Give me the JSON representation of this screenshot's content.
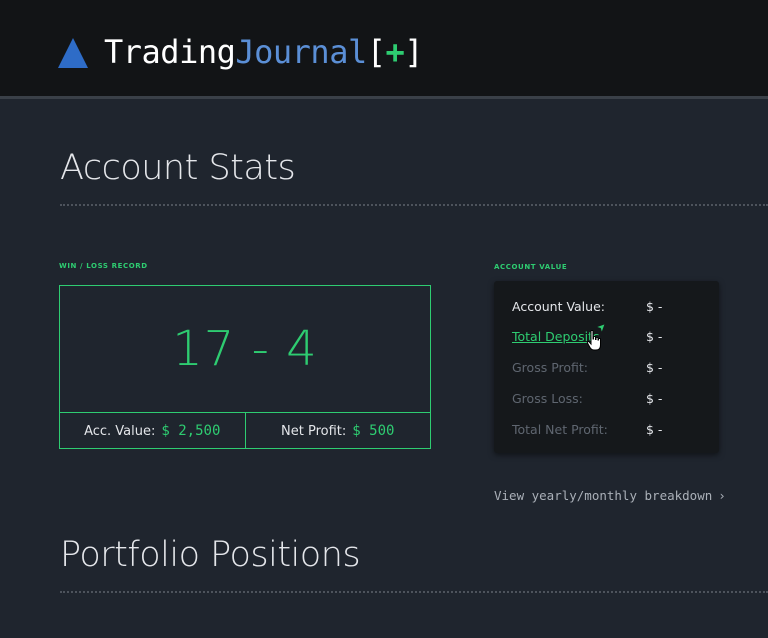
{
  "header": {
    "logo_part1": "Trading",
    "logo_part2": "Journal",
    "logo_open": "[",
    "logo_plus": "+",
    "logo_close": "]"
  },
  "account_stats": {
    "title": "Account Stats",
    "win_loss": {
      "label": "WIN / LOSS RECORD",
      "record": "17 - 4",
      "acc_value_label": "Acc. Value:",
      "acc_value": "$ 2,500",
      "net_profit_label": "Net Profit:",
      "net_profit": "$ 500"
    },
    "account_value": {
      "label": "ACCOUNT VALUE",
      "rows": [
        {
          "label": "Account Value:",
          "value": "$  -"
        },
        {
          "label": "Total Deposits",
          "value": "$  -"
        },
        {
          "label": "Gross Profit:",
          "value": "$  -"
        },
        {
          "label": "Gross Loss:",
          "value": "$  -"
        },
        {
          "label": "Total Net Profit:",
          "value": "$  -"
        }
      ]
    },
    "breakdown_link": "View yearly/monthly breakdown",
    "breakdown_chevron": "›"
  },
  "portfolio": {
    "title": "Portfolio Positions"
  },
  "colors": {
    "accent": "#2ecc71",
    "logo_triangle": "#2e6cc7",
    "logo_journal": "#5b8fd6",
    "background": "#1f252e",
    "header": "#121416"
  }
}
